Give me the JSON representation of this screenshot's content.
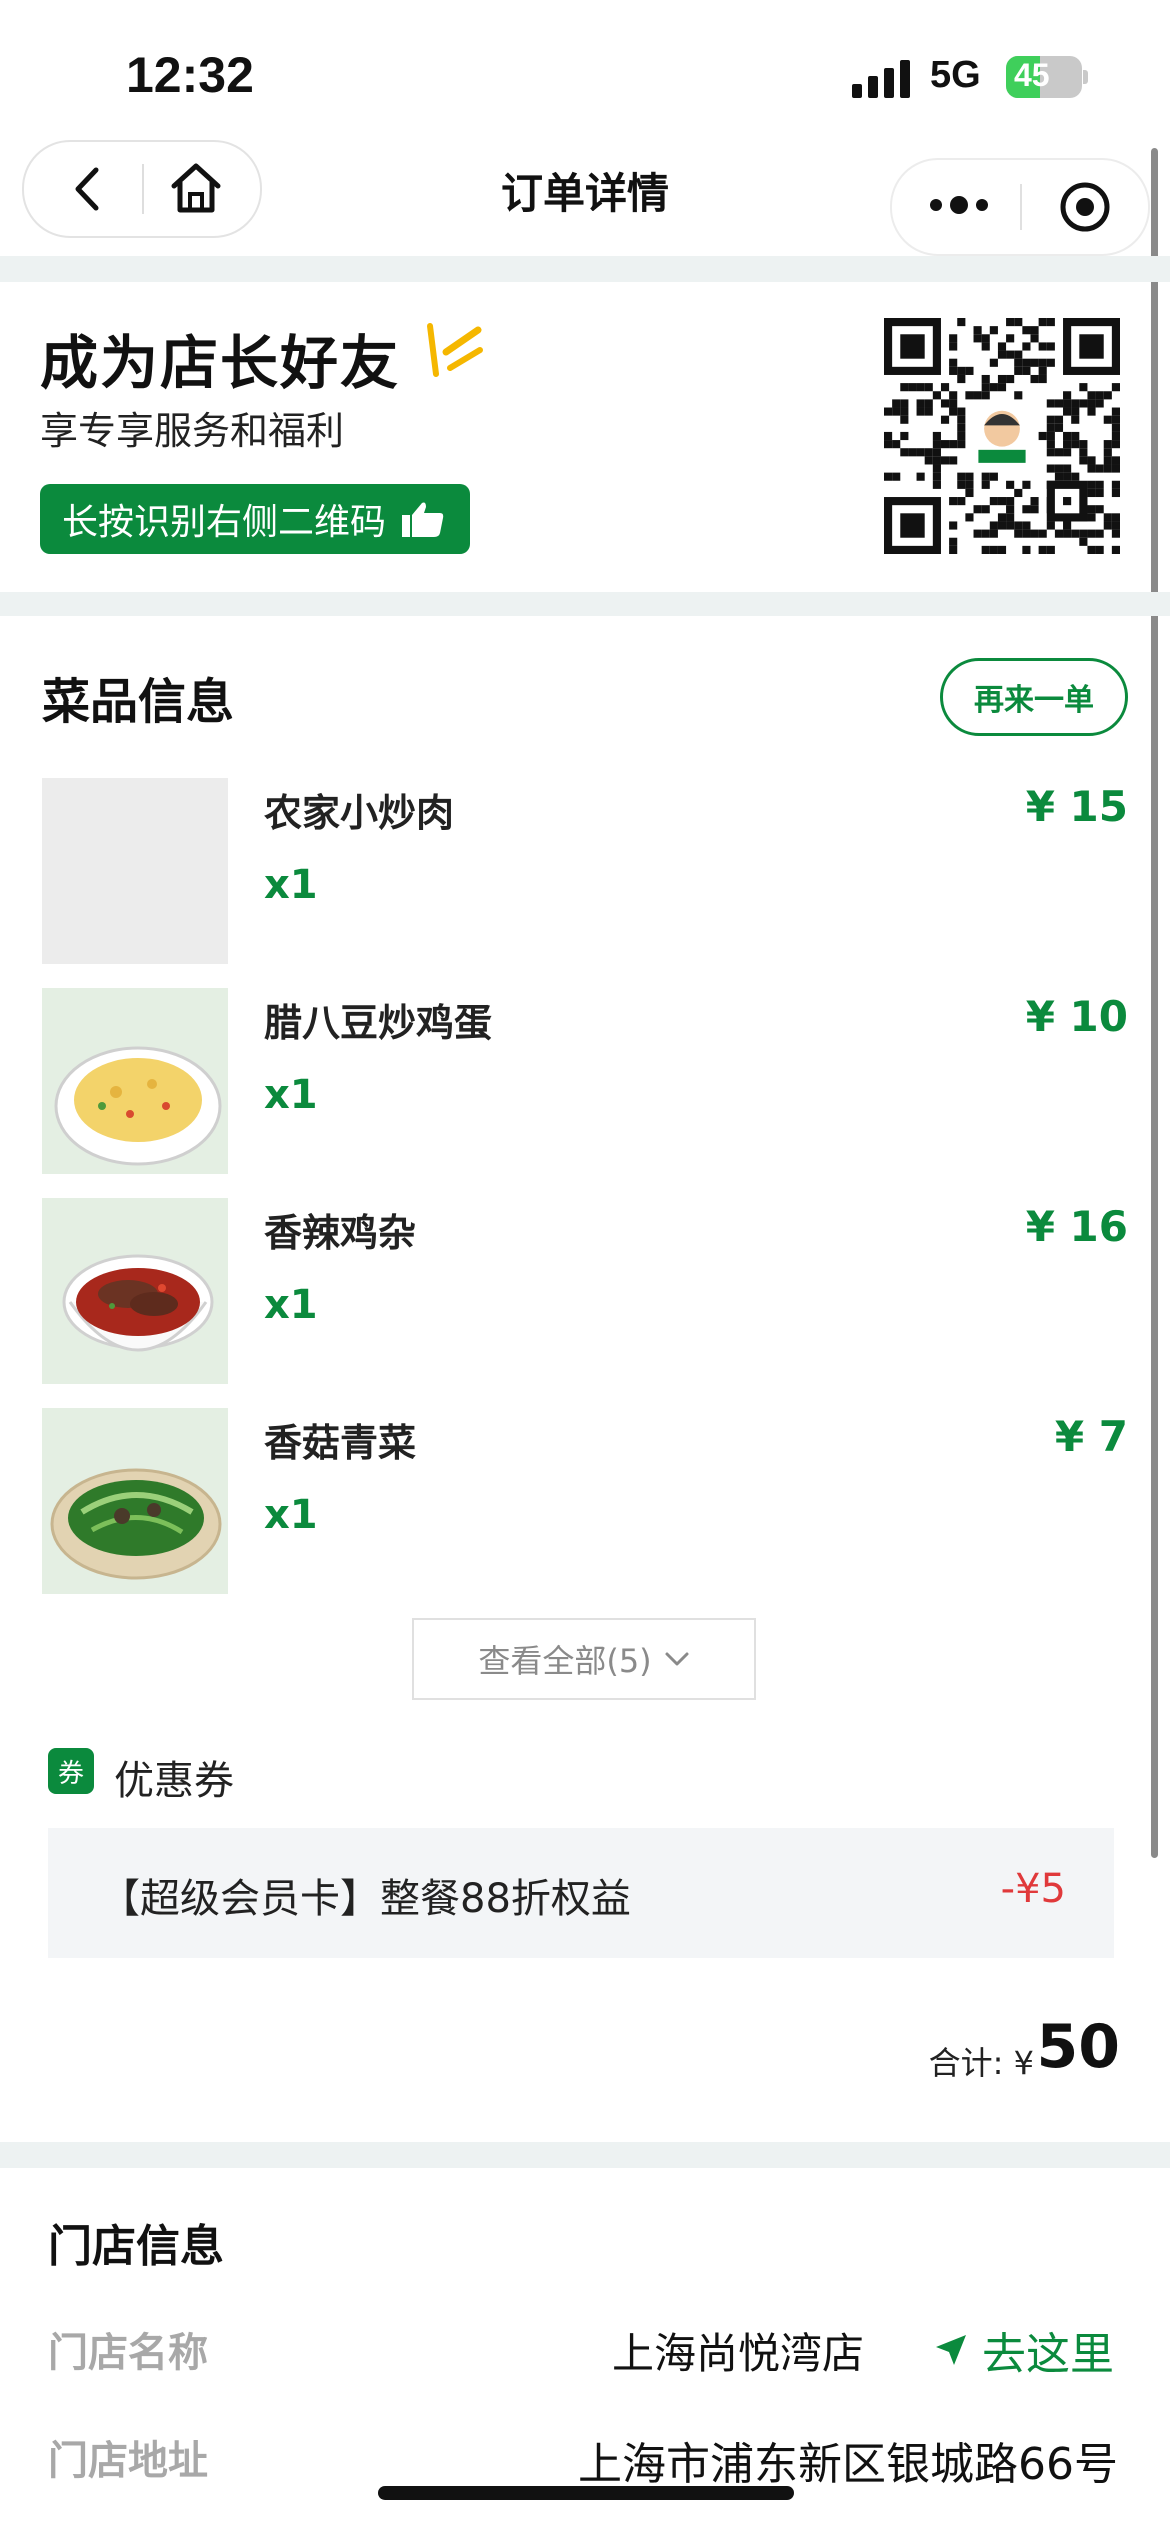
{
  "status_bar": {
    "time": "12:32",
    "network": "5G",
    "battery": "45",
    "battery_level": 0.45
  },
  "nav": {
    "title": "订单详情",
    "back_icon": "chevron-left-icon",
    "home_icon": "home-icon",
    "more_icon": "more-dots-icon",
    "record_icon": "target-icon"
  },
  "promo": {
    "title": "成为店长好友",
    "subtitle": "享专享服务和福利",
    "button_label": "长按识别右侧二维码"
  },
  "dishes": {
    "section_title": "菜品信息",
    "reorder_label": "再来一单",
    "items": [
      {
        "name": "农家小炒肉",
        "qty": "x1",
        "price": "¥ 15"
      },
      {
        "name": "腊八豆炒鸡蛋",
        "qty": "x1",
        "price": "¥ 10"
      },
      {
        "name": "香辣鸡杂",
        "qty": "x1",
        "price": "¥ 16"
      },
      {
        "name": "香菇青菜",
        "qty": "x1",
        "price": "¥ 7"
      }
    ],
    "view_all_label": "查看全部(5)"
  },
  "coupon": {
    "badge": "券",
    "label": "优惠券",
    "text": "【超级会员卡】整餐88折权益",
    "amount": "-¥5"
  },
  "total": {
    "label": "合计: ¥",
    "value": "50"
  },
  "store": {
    "section_title": "门店信息",
    "name_label": "门店名称",
    "name": "上海尚悦湾店",
    "goto_label": "去这里",
    "address_label": "门店地址",
    "address": "上海市浦东新区银城路66号"
  },
  "colors": {
    "accent": "#0b8a3d",
    "discount": "#e0393b",
    "band": "#edf2f2"
  }
}
